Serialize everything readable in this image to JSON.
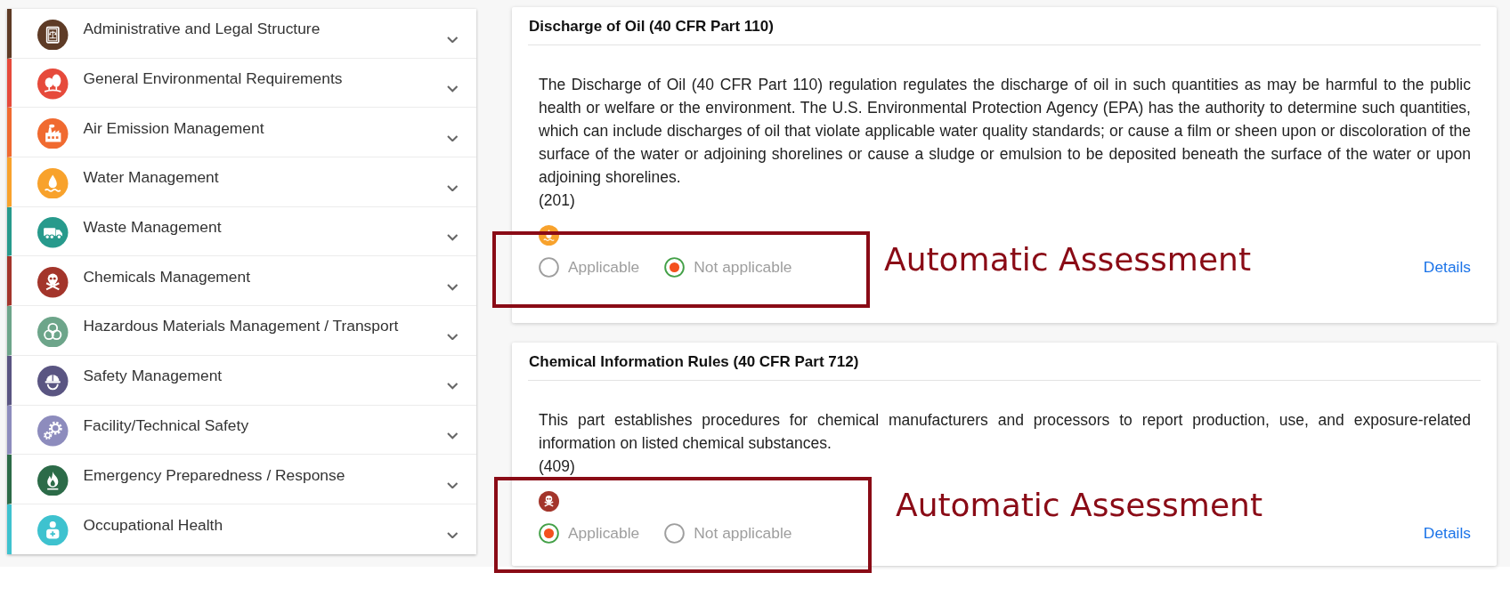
{
  "sidebar": {
    "items": [
      {
        "label": "Administrative and Legal Structure",
        "color": "#5e3b26",
        "expanded": false
      },
      {
        "label": "General Environmental Requirements",
        "color": "#e64a3b",
        "expanded": false
      },
      {
        "label": "Air Emission Management",
        "color": "#f06a30",
        "expanded": false
      },
      {
        "label": "Water Management",
        "color": "#f8a22c",
        "expanded": false
      },
      {
        "label": "Waste Management",
        "color": "#279a8c",
        "expanded": false
      },
      {
        "label": "Chemicals Management",
        "color": "#a3352b",
        "expanded": false
      },
      {
        "label": "Hazardous Materials Management / Transport",
        "color": "#6da58a",
        "expanded": false
      },
      {
        "label": "Safety Management",
        "color": "#5a5582",
        "expanded": false
      },
      {
        "label": "Facility/Technical Safety",
        "color": "#8d8cbd",
        "expanded": false
      },
      {
        "label": "Emergency Preparedness / Response",
        "color": "#2c6b48",
        "expanded": false
      },
      {
        "label": "Occupational Health",
        "color": "#3ec2cf",
        "expanded": false
      }
    ]
  },
  "regulations": [
    {
      "title": "Discharge of Oil (40 CFR Part 110)",
      "description": "The Discharge of Oil (40 CFR Part 110) regulation regulates the discharge of oil in such quantities as may be harmful to the public health or welfare or the environment. The U.S. Environmental Protection Agency (EPA) has the authority to determine such quantities, which can include discharges of oil that violate applicable water quality standards; or cause a film or sheen upon or discoloration of the surface of the water or adjoining shorelines or cause a sludge or emulsion to be deposited beneath the surface of the water or upon adjoining shorelines.",
      "reference": "(201)",
      "color": "#f8a22c",
      "options": [
        {
          "label": "Applicable",
          "selected": false
        },
        {
          "label": "Not applicable",
          "selected": true
        }
      ],
      "details_link": "Details",
      "annotation": "Automatic Assessment"
    },
    {
      "title": "Chemical Information Rules (40 CFR Part 712)",
      "description": "This part establishes procedures for chemical manufacturers and processors to report production, use, and exposure-related information on listed chemical substances.",
      "reference": "(409)",
      "color": "#a3352b",
      "options": [
        {
          "label": "Applicable",
          "selected": true
        },
        {
          "label": "Not applicable",
          "selected": false
        }
      ],
      "details_link": "Details",
      "annotation": "Automatic Assessment"
    }
  ]
}
